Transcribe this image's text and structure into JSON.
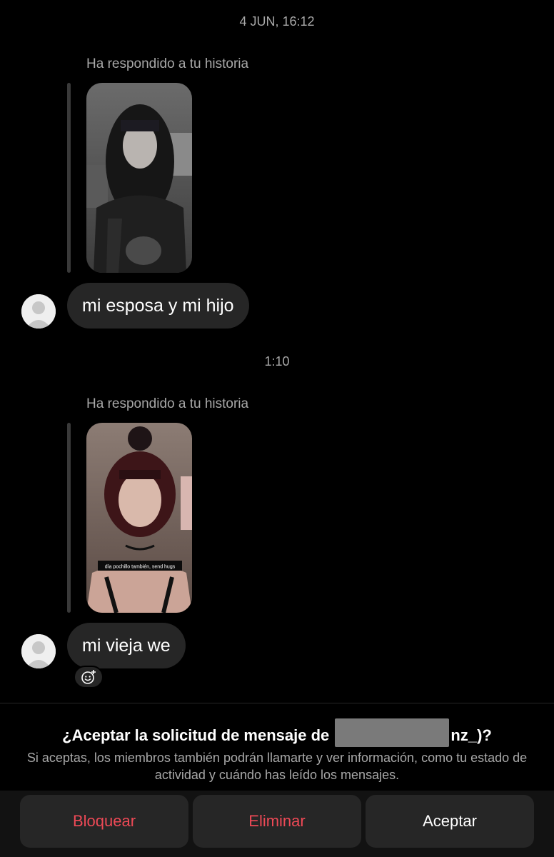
{
  "thread": {
    "messages": [
      {
        "timestamp": "4 JUN, 16:12",
        "reply_label": "Ha respondido a tu historia",
        "story_caption": "",
        "text": "mi esposa y mi hijo"
      },
      {
        "timestamp": "1:10",
        "reply_label": "Ha respondido a tu historia",
        "story_caption": "día pochillo también, send hugs",
        "text": "mi vieja we"
      }
    ]
  },
  "request": {
    "title_prefix": "¿Aceptar la solicitud de mensaje de ",
    "title_visible_start": "",
    "title_suffix": "nz_)?",
    "description": "Si aceptas, los miembros también podrán llamarte y ver información, como tu estado de actividad y cuándo has leído los mensajes."
  },
  "actions": {
    "block_label": "Bloquear",
    "delete_label": "Eliminar",
    "accept_label": "Aceptar"
  },
  "colors": {
    "background": "#000000",
    "bubble": "#262626",
    "muted_text": "#a8a8a8",
    "destructive": "#ed4956",
    "button_bar": "#121212"
  }
}
